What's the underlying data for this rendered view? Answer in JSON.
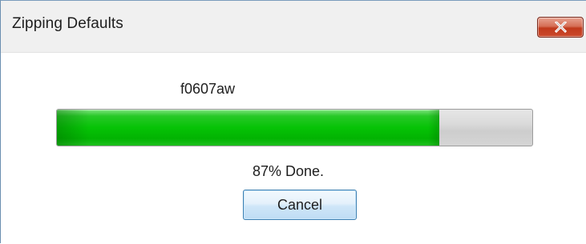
{
  "window": {
    "title": "Zipping Defaults",
    "close_icon": "close-icon"
  },
  "progress": {
    "filename": "f0607aw",
    "fraction": 0.805,
    "status_text": "87% Done.",
    "fill_color": "#06c306",
    "track_color": "#d5d5d5"
  },
  "actions": {
    "cancel_label": "Cancel"
  },
  "colors": {
    "close_button": "#c0391c",
    "cancel_border": "#3c7fb1"
  }
}
